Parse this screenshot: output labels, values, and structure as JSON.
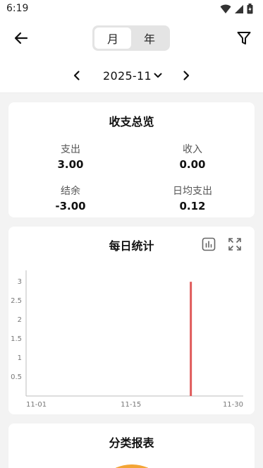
{
  "status_bar": {
    "time": "6:19"
  },
  "header": {
    "period_tabs": [
      {
        "label": "月",
        "active": true
      },
      {
        "label": "年",
        "active": false
      }
    ],
    "month": "2025-11"
  },
  "summary": {
    "title": "收支总览",
    "items": [
      {
        "label": "支出",
        "value": "3.00"
      },
      {
        "label": "收入",
        "value": "0.00"
      },
      {
        "label": "结余",
        "value": "-3.00"
      },
      {
        "label": "日均支出",
        "value": "0.12"
      }
    ]
  },
  "daily": {
    "title": "每日统计",
    "icons": [
      "bar-chart-icon",
      "fullscreen-icon"
    ]
  },
  "category": {
    "title": "分类报表"
  },
  "colors": {
    "accent": "#e05a5a",
    "card_bg": "#ffffff",
    "page_bg": "#f3f3f3",
    "donut_hint": "#f3a535"
  },
  "chart_data": {
    "type": "bar",
    "x_tick_labels": [
      "11-01",
      "11-15",
      "11-30"
    ],
    "y_ticks": [
      0.5,
      1,
      1.5,
      2,
      2.5,
      3
    ],
    "y_tick_labels": [
      "0.5",
      "1",
      "1.5",
      "2",
      "2.5",
      "3"
    ],
    "ylim": [
      0,
      3.3
    ],
    "x_domain": [
      1,
      30
    ],
    "points": [
      {
        "day": 23,
        "value": 3
      }
    ],
    "series_color": "#e05a5a",
    "grid": false
  }
}
